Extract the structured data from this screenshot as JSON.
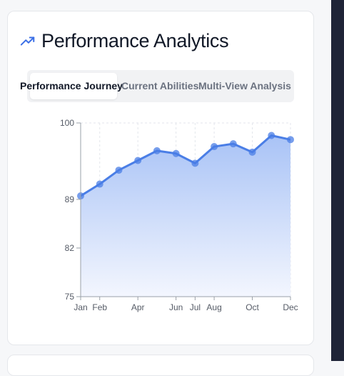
{
  "header": {
    "title": "Performance Analytics",
    "icon": "trending-up-icon",
    "accent": "#3b6fe6"
  },
  "tabs": [
    {
      "label": "Performance Journey",
      "active": true
    },
    {
      "label": "Current Abilities",
      "active": false
    },
    {
      "label": "Multi-View Analysis",
      "active": false
    }
  ],
  "colors": {
    "line": "#4a7ee6",
    "area_top": "#a9c3f6",
    "area_bottom": "#f3f6fe"
  },
  "chart_data": {
    "type": "area",
    "x_ticks": [
      "Jan",
      "Feb",
      "Apr",
      "Jun",
      "Jul",
      "Aug",
      "Oct",
      "Dec"
    ],
    "y_ticks": [
      75,
      82,
      89,
      100
    ],
    "ylim": [
      75,
      100
    ],
    "points": [
      {
        "x": 0,
        "y": 89.5
      },
      {
        "x": 1,
        "y": 91.2
      },
      {
        "x": 2,
        "y": 93.2
      },
      {
        "x": 3,
        "y": 94.6
      },
      {
        "x": 4,
        "y": 96.0
      },
      {
        "x": 5,
        "y": 95.6
      },
      {
        "x": 6,
        "y": 94.2
      },
      {
        "x": 7,
        "y": 96.6
      },
      {
        "x": 8,
        "y": 97.0
      },
      {
        "x": 9,
        "y": 95.8
      },
      {
        "x": 10,
        "y": 98.2
      },
      {
        "x": 11,
        "y": 97.6
      }
    ],
    "tick_months": [
      0,
      1,
      3,
      5,
      6,
      7,
      9,
      11
    ],
    "grid": true
  }
}
